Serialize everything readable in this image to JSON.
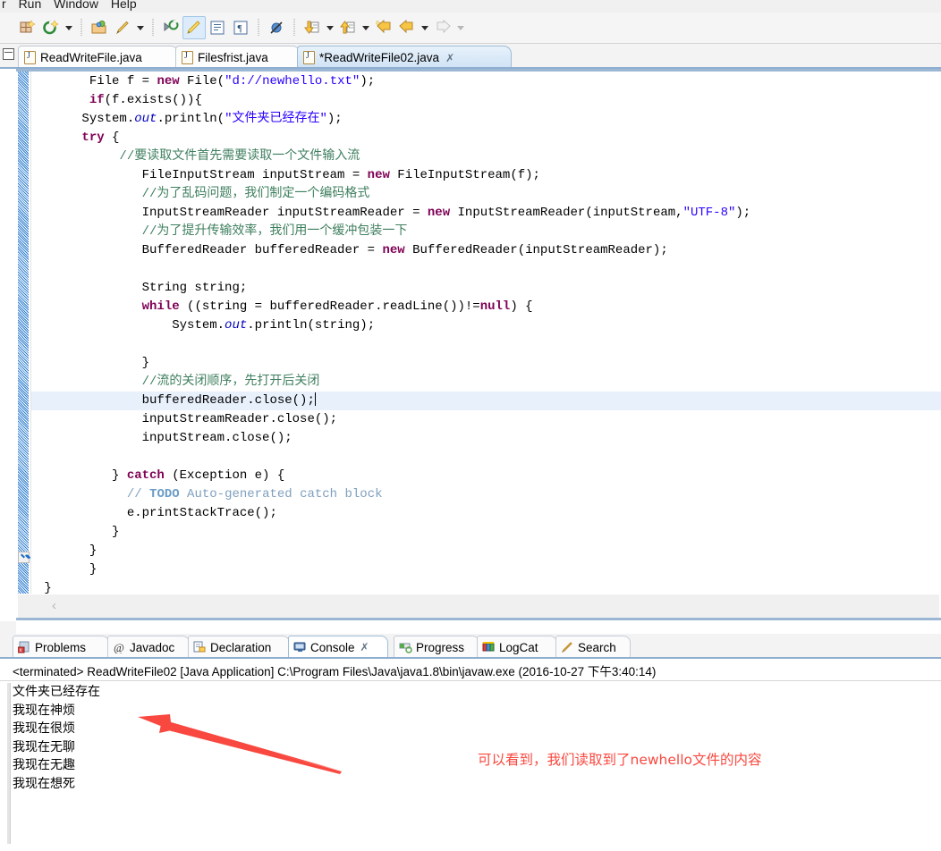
{
  "menu": {
    "items": [
      "r",
      "Run",
      "Window",
      "Help"
    ]
  },
  "toolbar": {
    "buttons": [
      {
        "name": "new-wizard",
        "icon": "new-wizard-icon"
      },
      {
        "name": "new-java-project",
        "icon": "new-java-project-icon"
      },
      {
        "name": "open-type",
        "icon": "open-type-icon"
      },
      {
        "name": "external-tools",
        "icon": "external-tools-icon"
      },
      {
        "name": "debug-last",
        "icon": "debug-last-icon"
      },
      {
        "name": "toggle-mark-occurrences",
        "icon": "highlighter-icon"
      },
      {
        "name": "show-whitespace",
        "icon": "show-whitespace-icon"
      },
      {
        "name": "toggle-block-selection",
        "icon": "pilcrow-icon"
      },
      {
        "name": "skip-breakpoints",
        "icon": "skip-all-breakpoints-icon"
      },
      {
        "name": "step-into",
        "icon": "down-arrow-doc-icon"
      },
      {
        "name": "step-return",
        "icon": "up-arrow-doc-icon"
      },
      {
        "name": "last-edit-location",
        "icon": "last-edit-location-icon"
      },
      {
        "name": "back",
        "icon": "back-arrow-icon"
      },
      {
        "name": "forward",
        "icon": "forward-arrow-icon"
      }
    ]
  },
  "editor_tabs": [
    {
      "label": "ReadWriteFile.java",
      "active": false,
      "dirty": false,
      "closable": false
    },
    {
      "label": "Filesfrist.java",
      "active": false,
      "dirty": false,
      "closable": false
    },
    {
      "label": "*ReadWriteFile02.java",
      "active": true,
      "dirty": true,
      "closable": true
    }
  ],
  "editor": {
    "close_glyph": "✗",
    "scroll_left_glyph": "‹",
    "code_lines": [
      {
        "indent": 7,
        "highlight": false,
        "parts": [
          {
            "t": "File f = ",
            "c": ""
          },
          {
            "t": "new",
            "c": "kw"
          },
          {
            "t": " File(",
            "c": ""
          },
          {
            "t": "\"d://newhello.txt\"",
            "c": "str"
          },
          {
            "t": ");",
            "c": ""
          }
        ]
      },
      {
        "indent": 7,
        "highlight": false,
        "parts": [
          {
            "t": "if",
            "c": "kw"
          },
          {
            "t": "(f.exists()){",
            "c": ""
          }
        ]
      },
      {
        "indent": 6,
        "highlight": false,
        "parts": [
          {
            "t": "System.",
            "c": ""
          },
          {
            "t": "out",
            "c": "fld"
          },
          {
            "t": ".println(",
            "c": ""
          },
          {
            "t": "\"文件夹已经存在\"",
            "c": "str"
          },
          {
            "t": ");",
            "c": ""
          }
        ]
      },
      {
        "indent": 6,
        "highlight": false,
        "parts": [
          {
            "t": "try",
            "c": "kw"
          },
          {
            "t": " {",
            "c": ""
          }
        ]
      },
      {
        "indent": 11,
        "highlight": false,
        "parts": [
          {
            "t": "//要读取文件首先需要读取一个文件输入流",
            "c": "cmt"
          }
        ]
      },
      {
        "indent": 14,
        "highlight": false,
        "parts": [
          {
            "t": "FileInputStream inputStream = ",
            "c": ""
          },
          {
            "t": "new",
            "c": "kw"
          },
          {
            "t": " FileInputStream(f);",
            "c": ""
          }
        ]
      },
      {
        "indent": 14,
        "highlight": false,
        "parts": [
          {
            "t": "//为了乱码问题，我们制定一个编码格式",
            "c": "cmt"
          }
        ]
      },
      {
        "indent": 14,
        "highlight": false,
        "parts": [
          {
            "t": "InputStreamReader inputStreamReader = ",
            "c": ""
          },
          {
            "t": "new",
            "c": "kw"
          },
          {
            "t": " InputStreamReader(inputStream,",
            "c": ""
          },
          {
            "t": "\"UTF-8\"",
            "c": "str"
          },
          {
            "t": ");",
            "c": ""
          }
        ]
      },
      {
        "indent": 14,
        "highlight": false,
        "parts": [
          {
            "t": "//为了提升传输效率，我们用一个缓冲包装一下",
            "c": "cmt"
          }
        ]
      },
      {
        "indent": 14,
        "highlight": false,
        "parts": [
          {
            "t": "BufferedReader bufferedReader = ",
            "c": ""
          },
          {
            "t": "new",
            "c": "kw"
          },
          {
            "t": " BufferedReader(inputStreamReader);",
            "c": ""
          }
        ]
      },
      {
        "indent": 0,
        "highlight": false,
        "parts": []
      },
      {
        "indent": 14,
        "highlight": false,
        "parts": [
          {
            "t": "String string;",
            "c": ""
          }
        ]
      },
      {
        "indent": 14,
        "highlight": false,
        "parts": [
          {
            "t": "while",
            "c": "kw"
          },
          {
            "t": " ((string = bufferedReader.readLine())!=",
            "c": ""
          },
          {
            "t": "null",
            "c": "kw"
          },
          {
            "t": ") {",
            "c": ""
          }
        ]
      },
      {
        "indent": 18,
        "highlight": false,
        "parts": [
          {
            "t": "System.",
            "c": ""
          },
          {
            "t": "out",
            "c": "fld"
          },
          {
            "t": ".println(string);",
            "c": ""
          }
        ]
      },
      {
        "indent": 0,
        "highlight": false,
        "parts": []
      },
      {
        "indent": 14,
        "highlight": false,
        "parts": [
          {
            "t": "}",
            "c": ""
          }
        ]
      },
      {
        "indent": 14,
        "highlight": false,
        "parts": [
          {
            "t": "//流的关闭顺序，先打开后关闭",
            "c": "cmt"
          }
        ]
      },
      {
        "indent": 14,
        "highlight": true,
        "parts": [
          {
            "t": "bufferedReader.close();",
            "c": ""
          },
          {
            "t": "|",
            "c": "caret"
          }
        ]
      },
      {
        "indent": 14,
        "highlight": false,
        "parts": [
          {
            "t": "inputStreamReader.close();",
            "c": ""
          }
        ]
      },
      {
        "indent": 14,
        "highlight": false,
        "parts": [
          {
            "t": "inputStream.close();",
            "c": ""
          }
        ]
      },
      {
        "indent": 0,
        "highlight": false,
        "parts": []
      },
      {
        "indent": 10,
        "highlight": false,
        "parts": [
          {
            "t": "} ",
            "c": ""
          },
          {
            "t": "catch",
            "c": "kw"
          },
          {
            "t": " (Exception e) {",
            "c": ""
          }
        ]
      },
      {
        "indent": 12,
        "highlight": false,
        "parts": [
          {
            "t": "// ",
            "c": "cmt2"
          },
          {
            "t": "TODO",
            "c": "todo"
          },
          {
            "t": " Auto-generated catch block",
            "c": "cmt2"
          }
        ]
      },
      {
        "indent": 12,
        "highlight": false,
        "parts": [
          {
            "t": "e.printStackTrace();",
            "c": ""
          }
        ]
      },
      {
        "indent": 10,
        "highlight": false,
        "parts": [
          {
            "t": "}",
            "c": ""
          }
        ]
      },
      {
        "indent": 7,
        "highlight": false,
        "parts": [
          {
            "t": "}",
            "c": ""
          }
        ]
      },
      {
        "indent": 7,
        "highlight": false,
        "parts": [
          {
            "t": "}",
            "c": ""
          }
        ]
      },
      {
        "indent": 1,
        "highlight": false,
        "parts": [
          {
            "t": "}",
            "c": ""
          }
        ]
      }
    ]
  },
  "view_tabs": [
    {
      "label": "Problems",
      "icon": "problems-icon",
      "active": false,
      "closable": false
    },
    {
      "label": "Javadoc",
      "icon": "javadoc-at-icon",
      "active": false,
      "closable": false
    },
    {
      "label": "Declaration",
      "icon": "declaration-icon",
      "active": false,
      "closable": false
    },
    {
      "label": "Console",
      "icon": "console-icon",
      "active": true,
      "closable": true
    },
    {
      "label": "Progress",
      "icon": "progress-icon",
      "active": false,
      "closable": false
    },
    {
      "label": "LogCat",
      "icon": "logcat-icon",
      "active": false,
      "closable": false
    },
    {
      "label": "Search",
      "icon": "search-pencil-icon",
      "active": false,
      "closable": false
    }
  ],
  "console": {
    "header": "<terminated> ReadWriteFile02 [Java Application] C:\\Program Files\\Java\\java1.8\\bin\\javaw.exe (2016-10-27 下午3:40:14)",
    "output_lines": [
      "文件夹已经存在",
      "我现在神烦",
      "我现在很烦",
      "我现在无聊",
      "我现在无趣",
      "我现在想死"
    ]
  },
  "annotation": {
    "text": "可以看到，我们读取到了newhello文件的内容",
    "color": "#f8483f"
  },
  "colors": {
    "keyword": "#7f0055",
    "string": "#2a00ff",
    "comment": "#3f7f5f",
    "javadoc_comment": "#7f9fbf",
    "field": "#0000c0",
    "tab_active_bg": "#d7e9fa",
    "accent_border": "#8fafd0",
    "highlight_line": "#e8f0fb"
  }
}
